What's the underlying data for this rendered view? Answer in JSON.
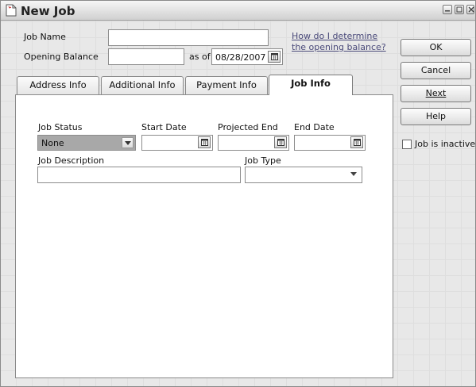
{
  "window": {
    "title": "New Job"
  },
  "form": {
    "job_name_label": "Job Name",
    "job_name_value": "",
    "opening_balance_label": "Opening Balance",
    "opening_balance_value": "",
    "as_of_label": "as of",
    "as_of_date": "08/28/2007",
    "help_link_line1": "How do I determine",
    "help_link_line2": "the opening balance?"
  },
  "tabs": [
    {
      "label": "Address Info",
      "active": false
    },
    {
      "label": "Additional Info",
      "active": false
    },
    {
      "label": "Payment Info",
      "active": false
    },
    {
      "label": "Job Info",
      "active": true
    }
  ],
  "job_info": {
    "job_status_label": "Job Status",
    "job_status_value": "None",
    "start_date_label": "Start Date",
    "start_date_value": "",
    "projected_end_label": "Projected End",
    "projected_end_value": "",
    "end_date_label": "End Date",
    "end_date_value": "",
    "job_description_label": "Job Description",
    "job_description_value": "",
    "job_type_label": "Job Type",
    "job_type_value": ""
  },
  "side_buttons": {
    "ok": "OK",
    "cancel": "Cancel",
    "next": "Next",
    "help": "Help"
  },
  "inactive": {
    "label": "Job is inactive",
    "checked": false
  },
  "colors": {
    "selected_status_bg": "#a8a8a8",
    "link": "#4a4a7a"
  }
}
